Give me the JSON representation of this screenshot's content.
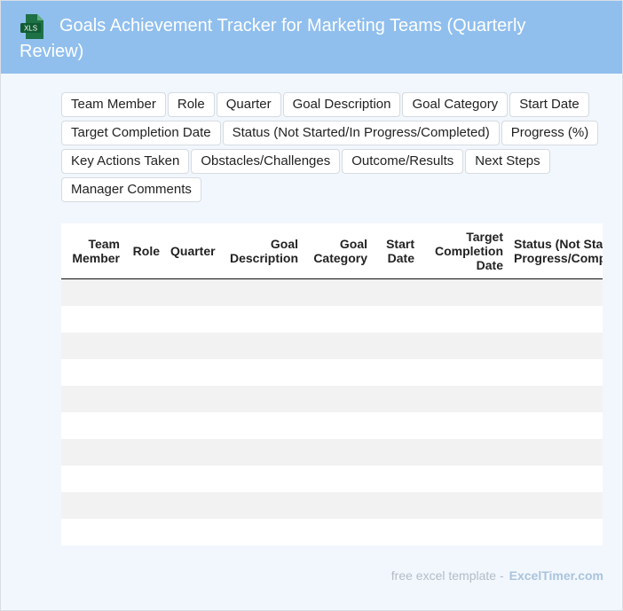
{
  "header": {
    "title": "Goals Achievement Tracker for Marketing Teams (Quarterly Review)",
    "icon_label": "XLS"
  },
  "chips": [
    "Team Member",
    "Role",
    "Quarter",
    "Goal Description",
    "Goal Category",
    "Start Date",
    "Target Completion Date",
    "Status (Not Started/In Progress/Completed)",
    "Progress (%)",
    "Key Actions Taken",
    "Obstacles/Challenges",
    "Outcome/Results",
    "Next Steps",
    "Manager Comments"
  ],
  "table": {
    "columns": [
      "Team Member",
      "Role",
      "Quarter",
      "Goal Description",
      "Goal Category",
      "Start Date",
      "Target Completion Date",
      "Status (Not Started/In Progress/Completed)"
    ],
    "row_count": 10
  },
  "footer": {
    "text": "free excel template -",
    "brand": "ExcelTimer.com"
  },
  "colors": {
    "header_bg": "#90bfee",
    "page_bg": "#f2f7fd",
    "icon_green": "#1e7145"
  }
}
